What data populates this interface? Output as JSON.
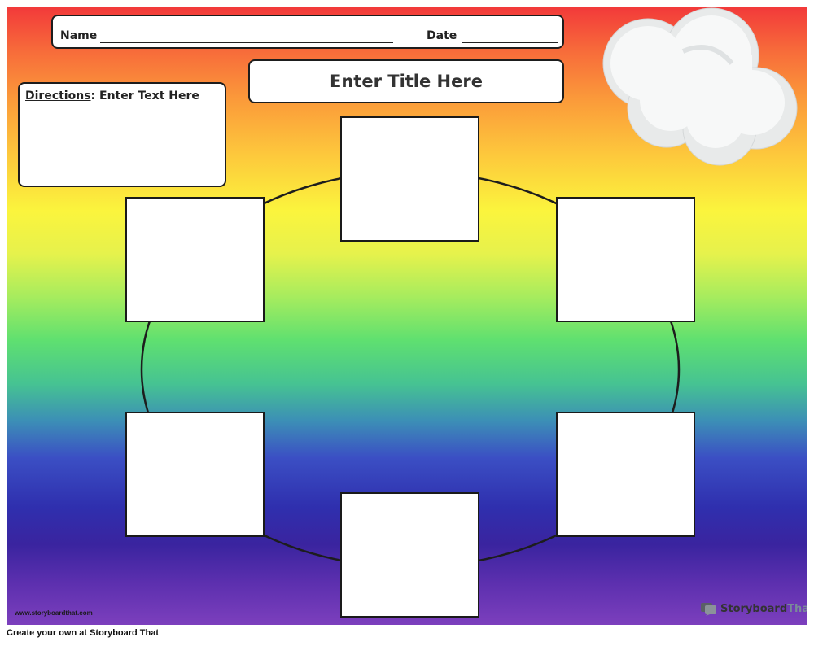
{
  "header": {
    "name_label": "Name",
    "date_label": "Date"
  },
  "title": {
    "text": "Enter Title Here"
  },
  "directions": {
    "label": "Directions",
    "text": ": Enter Text Here"
  },
  "cycle": {
    "boxes": [
      "",
      "",
      "",
      "",
      "",
      ""
    ]
  },
  "watermark": {
    "text": "www.storyboardthat.com"
  },
  "brand": {
    "part1": "Storyboard",
    "part2": "That",
    "icon": "speech-bubble-icon"
  },
  "footer": {
    "text": "Create your own at Storyboard That"
  }
}
